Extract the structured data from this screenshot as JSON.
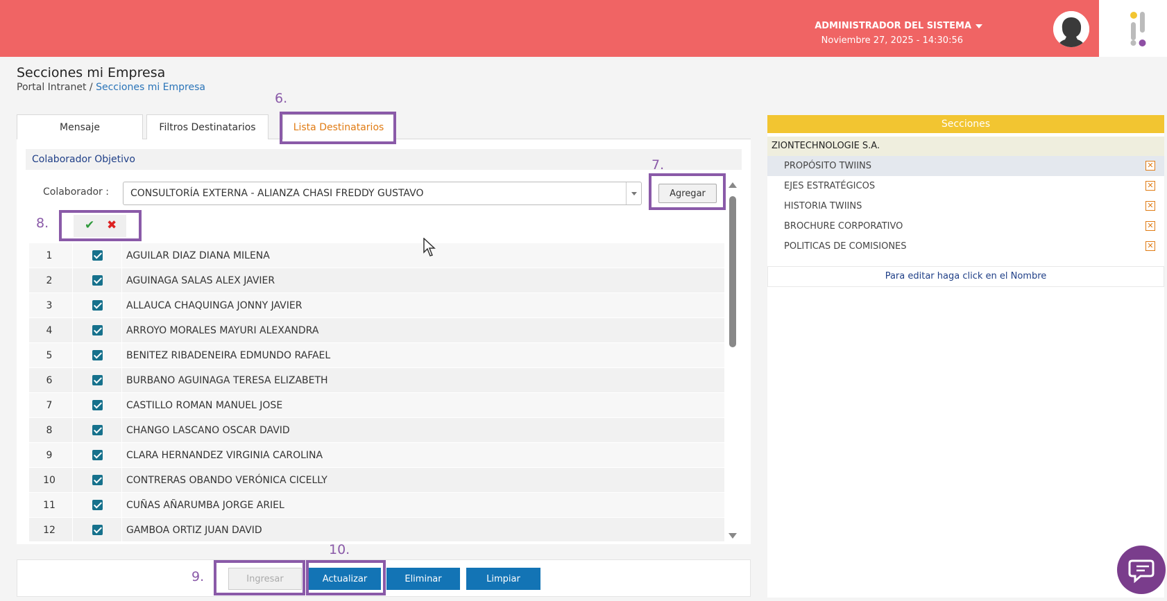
{
  "header": {
    "user_name": "ADMINISTRADOR DEL SISTEMA",
    "date_label": "Noviembre 27, 2025 -  14:30:56",
    "icons": [
      "chevron-down-icon",
      "avatar-icon",
      "brand-logo-icon"
    ]
  },
  "page": {
    "title": "Secciones mi Empresa",
    "breadcrumb_root": "Portal Intranet",
    "breadcrumb_sep": " / ",
    "breadcrumb_current": "Secciones mi Empresa"
  },
  "steps": {
    "s6": "6.",
    "s7": "7.",
    "s8": "8.",
    "s9": "9.",
    "s10": "10."
  },
  "tabs": [
    {
      "label": "Mensaje"
    },
    {
      "label": "Filtros Destinatarios"
    },
    {
      "label": "Lista Destinatarios"
    }
  ],
  "form": {
    "section_title": "Colaborador Objetivo",
    "colab_label": "Colaborador :",
    "colab_value": "CONSULTORÍA EXTERNA - ALIANZA CHASI FREDDY GUSTAVO",
    "add_button": "Agregar"
  },
  "recipients": [
    {
      "num": "1",
      "name": "AGUILAR DIAZ DIANA MILENA"
    },
    {
      "num": "2",
      "name": "AGUINAGA SALAS ALEX JAVIER"
    },
    {
      "num": "3",
      "name": "ALLAUCA CHAQUINGA JONNY JAVIER"
    },
    {
      "num": "4",
      "name": "ARROYO MORALES MAYURI ALEXANDRA"
    },
    {
      "num": "5",
      "name": "BENITEZ RIBADENEIRA EDMUNDO RAFAEL"
    },
    {
      "num": "6",
      "name": "BURBANO AGUINAGA TERESA ELIZABETH"
    },
    {
      "num": "7",
      "name": "CASTILLO ROMAN MANUEL JOSE"
    },
    {
      "num": "8",
      "name": "CHANGO LASCANO OSCAR DAVID"
    },
    {
      "num": "9",
      "name": "CLARA HERNANDEZ VIRGINIA CAROLINA"
    },
    {
      "num": "10",
      "name": "CONTRERAS OBANDO VERÓNICA CICELLY"
    },
    {
      "num": "11",
      "name": "CUÑAS AÑARUMBA JORGE ARIEL"
    },
    {
      "num": "12",
      "name": "GAMBOA ORTIZ JUAN DAVID"
    }
  ],
  "actions": {
    "ingresar": "Ingresar",
    "actualizar": "Actualizar",
    "eliminar": "Eliminar",
    "limpiar": "Limpiar"
  },
  "sections_panel": {
    "title": "Secciones",
    "company": "ZIONTECHNOLOGIE S.A.",
    "items": [
      {
        "label": "PROPÓSITO TWIINS"
      },
      {
        "label": "EJES ESTRATÉGICOS"
      },
      {
        "label": "HISTORIA TWIINS"
      },
      {
        "label": "BROCHURE CORPORATIVO"
      },
      {
        "label": "POLITICAS DE COMISIONES"
      }
    ],
    "edit_hint": "Para editar haga click en el Nombre"
  },
  "colors": {
    "header_bg": "#f06464",
    "primary_button": "#1374b5",
    "active_tab": "#e07b13",
    "highlight": "#8a5aa8",
    "sections_header": "#f2c531",
    "chat": "#7a3d8c"
  }
}
